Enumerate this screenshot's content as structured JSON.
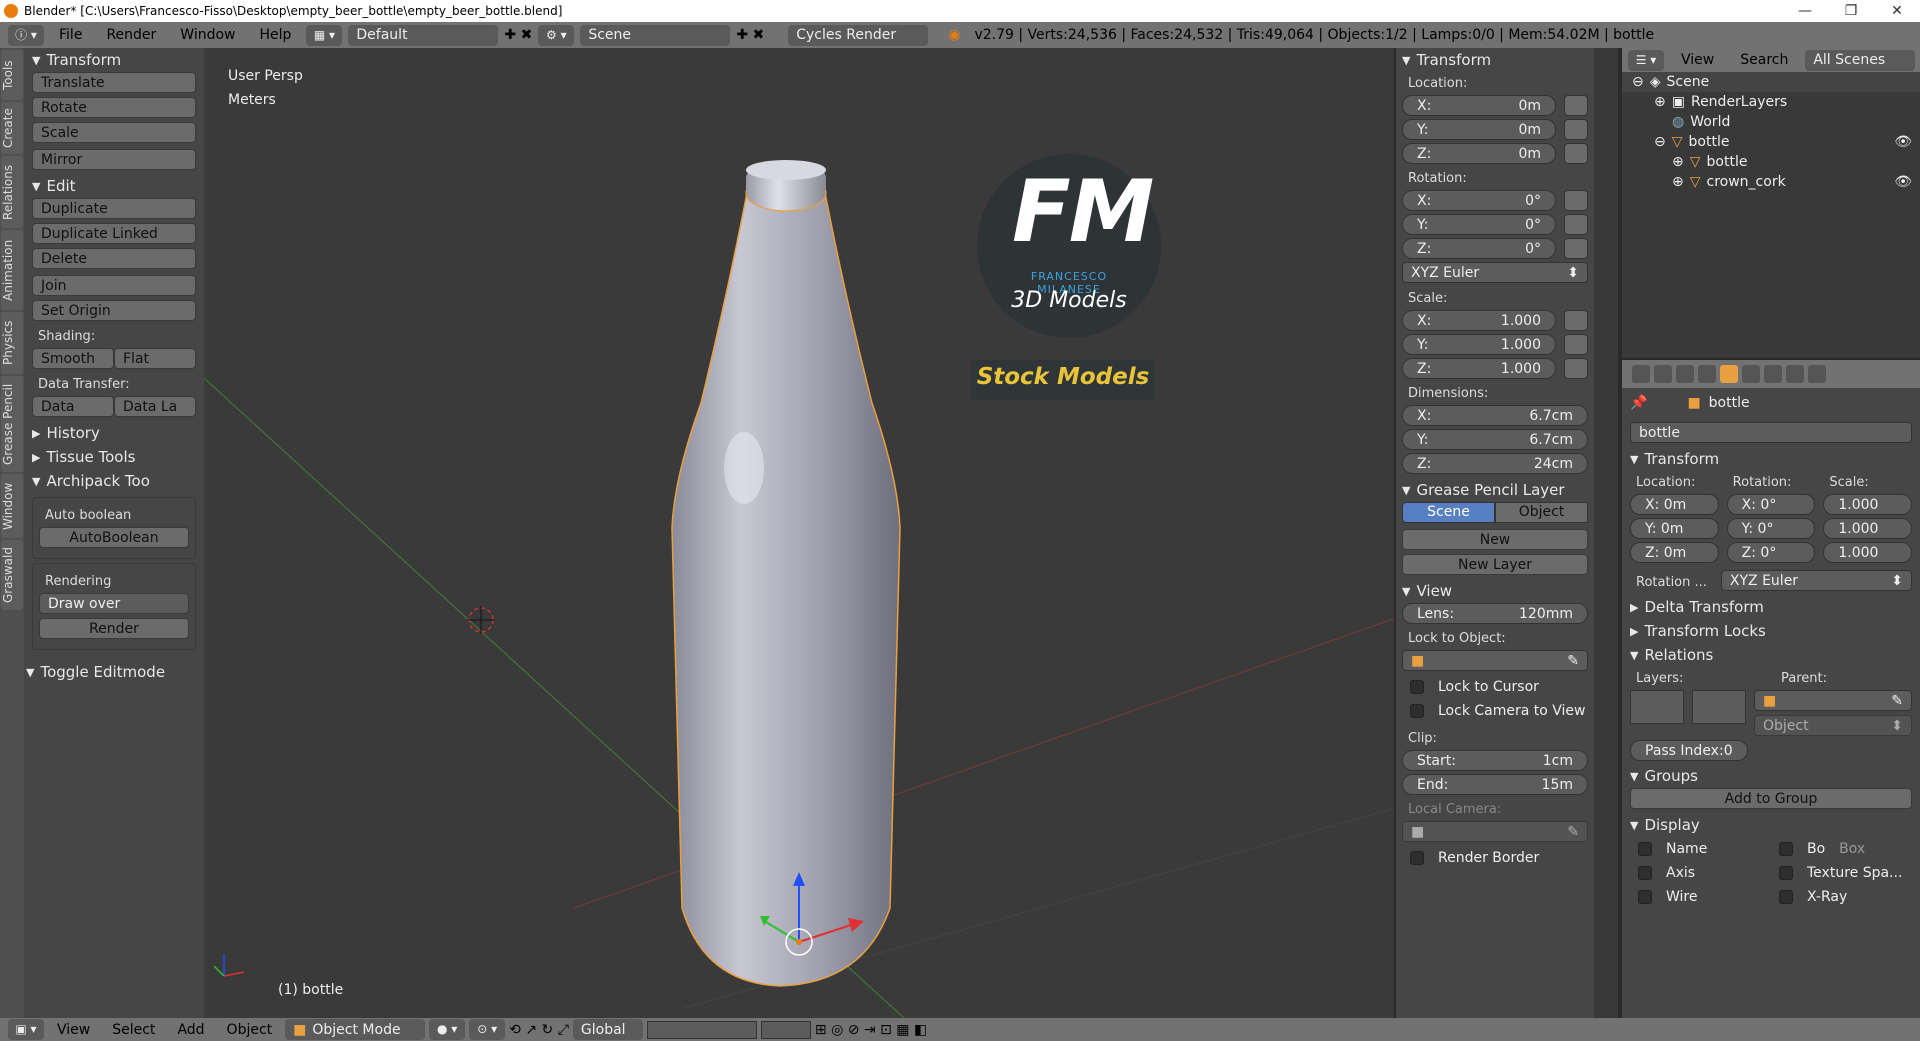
{
  "titlebar": {
    "title": "Blender* [C:\\Users\\Francesco-Fisso\\Desktop\\empty_beer_bottle\\empty_beer_bottle.blend]"
  },
  "topbar": {
    "menus": [
      "File",
      "Render",
      "Window",
      "Help"
    ],
    "layout": "Default",
    "scene": "Scene",
    "engine": "Cycles Render",
    "stats": "v2.79 | Verts:24,536 | Faces:24,532 | Tris:49,064 | Objects:1/2 | Lamps:0/0 | Mem:54.02M | bottle"
  },
  "vtabs": [
    "Tools",
    "Create",
    "Relations",
    "Animation",
    "Physics",
    "Grease Pencil",
    "Window",
    "Graswald"
  ],
  "toolshelf": {
    "transform_title": "Transform",
    "translate": "Translate",
    "rotate": "Rotate",
    "scale": "Scale",
    "mirror": "Mirror",
    "edit_title": "Edit",
    "duplicate": "Duplicate",
    "duplicate_linked": "Duplicate Linked",
    "delete": "Delete",
    "join": "Join",
    "set_origin": "Set Origin",
    "shading_label": "Shading:",
    "smooth": "Smooth",
    "flat": "Flat",
    "data_transfer_label": "Data Transfer:",
    "data": "Data",
    "data_la": "Data La",
    "history": "History",
    "tissue": "Tissue Tools",
    "archipack": "Archipack Too",
    "auto_boolean": "Auto boolean",
    "autoboolean_btn": "AutoBoolean",
    "rendering": "Rendering",
    "draw_over": "Draw over",
    "render": "Render",
    "toggle_editmode": "Toggle Editmode"
  },
  "viewport": {
    "persp": "User Persp",
    "units": "Meters",
    "object_label": "(1) bottle",
    "logo_fm": "FM",
    "logo_name": "FRANCESCO MILANESE",
    "logo_sub": "3D Models",
    "logo_stock": "Stock Models"
  },
  "npanel": {
    "transform_title": "Transform",
    "location_label": "Location:",
    "loc": [
      {
        "k": "X:",
        "v": "0m"
      },
      {
        "k": "Y:",
        "v": "0m"
      },
      {
        "k": "Z:",
        "v": "0m"
      }
    ],
    "rotation_label": "Rotation:",
    "rot": [
      {
        "k": "X:",
        "v": "0°"
      },
      {
        "k": "Y:",
        "v": "0°"
      },
      {
        "k": "Z:",
        "v": "0°"
      }
    ],
    "rot_mode": "XYZ Euler",
    "scale_label": "Scale:",
    "scl": [
      {
        "k": "X:",
        "v": "1.000"
      },
      {
        "k": "Y:",
        "v": "1.000"
      },
      {
        "k": "Z:",
        "v": "1.000"
      }
    ],
    "dimensions_label": "Dimensions:",
    "dim": [
      {
        "k": "X:",
        "v": "6.7cm"
      },
      {
        "k": "Y:",
        "v": "6.7cm"
      },
      {
        "k": "Z:",
        "v": "24cm"
      }
    ],
    "grease_title": "Grease Pencil Layer",
    "scene_btn": "Scene",
    "object_btn": "Object",
    "new_btn": "New",
    "new_layer": "New Layer",
    "view_title": "View",
    "lens_k": "Lens:",
    "lens_v": "120mm",
    "lock_to_object": "Lock to Object:",
    "lock_cursor": "Lock to Cursor",
    "lock_camera": "Lock Camera to View",
    "clip_label": "Clip:",
    "start_k": "Start:",
    "start_v": "1cm",
    "end_k": "End:",
    "end_v": "15m",
    "local_camera": "Local Camera:",
    "render_border": "Render Border"
  },
  "outliner": {
    "view": "View",
    "search": "Search",
    "all_scenes": "All Scenes",
    "items": [
      "Scene",
      "RenderLayers",
      "World",
      "bottle",
      "bottle",
      "crown_cork"
    ]
  },
  "props": {
    "breadcrumb": "bottle",
    "name": "bottle",
    "transform_title": "Transform",
    "location_label": "Location:",
    "rotation_label": "Rotation:",
    "scale_label": "Scale:",
    "loc": [
      "X: 0m",
      "Y: 0m",
      "Z: 0m"
    ],
    "rot": [
      "X:  0°",
      "Y:  0°",
      "Z:  0°"
    ],
    "scl": [
      "1.000",
      "1.000",
      "1.000"
    ],
    "rotation_mode_label": "Rotation ...",
    "rotation_mode": "XYZ Euler",
    "delta": "Delta Transform",
    "locks": "Transform Locks",
    "relations": "Relations",
    "layers_label": "Layers:",
    "parent_label": "Parent:",
    "parent_type": "Object",
    "pass_index": "Pass Index:0",
    "groups": "Groups",
    "add_group": "Add to Group",
    "display": "Display",
    "name_chk": "Name",
    "bo_chk": "Bo",
    "box": "Box",
    "axis": "Axis",
    "texture_space": "Texture Spa...",
    "wire": "Wire",
    "xray": "X-Ray"
  },
  "bottombar": {
    "view": "View",
    "select": "Select",
    "add": "Add",
    "object": "Object",
    "mode": "Object Mode",
    "orientation": "Global"
  }
}
